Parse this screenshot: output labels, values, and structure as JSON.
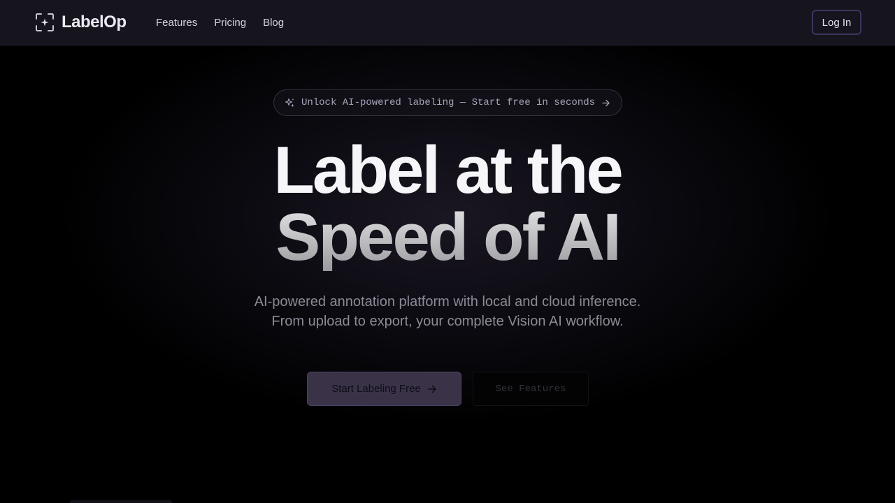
{
  "nav": {
    "brand_name": "LabelOp",
    "brand_icon": "focus-frame-icon",
    "links": [
      "Features",
      "Pricing",
      "Blog"
    ],
    "login_label": "Log In"
  },
  "hero": {
    "announcement": "Unlock AI-powered labeling — Start free in seconds",
    "announcement_icon": "sparkles-icon",
    "headline_line1": "Label at the",
    "headline_line2": "Speed of AI",
    "subtitle_line1": "AI-powered annotation platform with local and cloud inference.",
    "subtitle_line2": "From upload to export, your complete Vision AI workflow.",
    "cta_primary": "Start Labeling Free",
    "cta_secondary": "See Features"
  },
  "colors": {
    "background": "#000000",
    "nav_background": "#16141c",
    "accent_border": "#3b3560",
    "primary_button": "#3a3348"
  }
}
